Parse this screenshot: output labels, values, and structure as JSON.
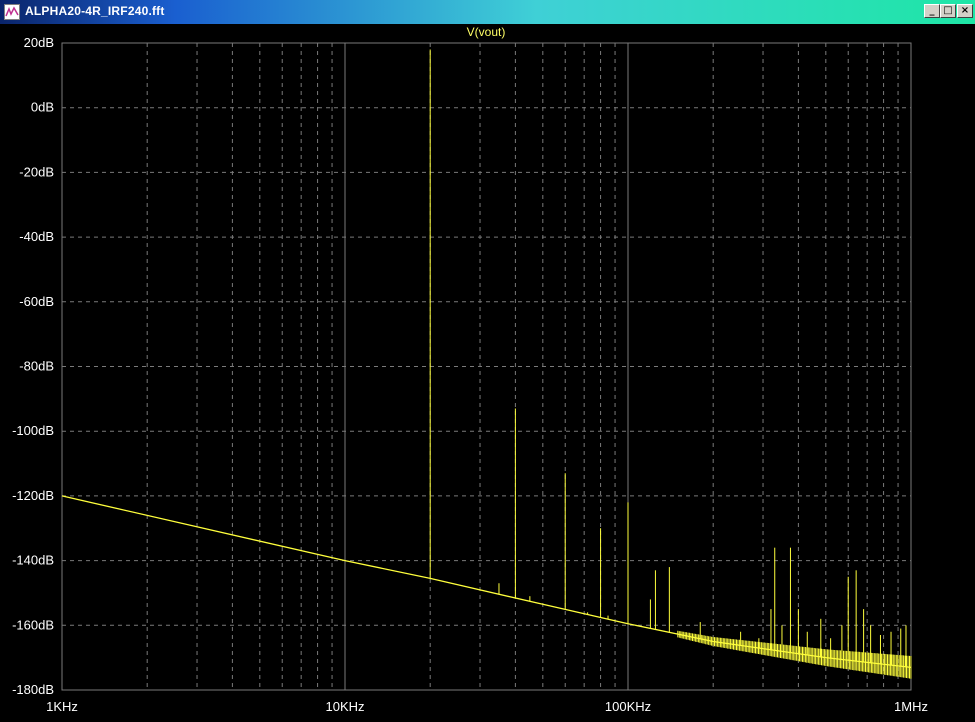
{
  "window": {
    "title": "ALPHA20-4R_IRF240.fft",
    "icon": "waveform-icon",
    "buttons": {
      "minimize": "_",
      "maximize": "□",
      "close": "×"
    }
  },
  "colors": {
    "background": "#000000",
    "grid": "#7a7a7a",
    "axis_text": "#ffffff",
    "trace": "#ffff3c",
    "trace_title": "#ffff66"
  },
  "chart_data": {
    "type": "line",
    "title": "V(vout)",
    "x_scale": "log",
    "xlim": [
      1000,
      1000000
    ],
    "ylim": [
      -180,
      20
    ],
    "x_tick_labels": [
      {
        "value": 1000,
        "label": "1KHz"
      },
      {
        "value": 10000,
        "label": "10KHz"
      },
      {
        "value": 100000,
        "label": "100KHz"
      },
      {
        "value": 1000000,
        "label": "1MHz"
      }
    ],
    "y_tick_labels": [
      {
        "value": 20,
        "label": "20dB"
      },
      {
        "value": 0,
        "label": "0dB"
      },
      {
        "value": -20,
        "label": "-20dB"
      },
      {
        "value": -40,
        "label": "-40dB"
      },
      {
        "value": -60,
        "label": "-60dB"
      },
      {
        "value": -80,
        "label": "-80dB"
      },
      {
        "value": -100,
        "label": "-100dB"
      },
      {
        "value": -120,
        "label": "-120dB"
      },
      {
        "value": -140,
        "label": "-140dB"
      },
      {
        "value": -160,
        "label": "-160dB"
      },
      {
        "value": -180,
        "label": "-180dB"
      }
    ],
    "grid": true,
    "series": [
      {
        "noise_floor": [
          [
            1000,
            -120
          ],
          [
            10000,
            -140
          ],
          [
            20000,
            -145.5
          ],
          [
            50000,
            -153.5
          ],
          [
            100000,
            -159.5
          ],
          [
            200000,
            -165
          ],
          [
            500000,
            -170
          ],
          [
            1000000,
            -173
          ]
        ],
        "spikes": [
          [
            20000,
            18
          ],
          [
            35000,
            -147
          ],
          [
            40000,
            -93
          ],
          [
            45000,
            -151
          ],
          [
            60000,
            -113
          ],
          [
            72000,
            -156
          ],
          [
            80000,
            -130
          ],
          [
            85000,
            -157
          ],
          [
            100000,
            -122
          ],
          [
            120000,
            -152
          ],
          [
            125000,
            -143
          ],
          [
            140000,
            -142
          ],
          [
            160000,
            -163
          ],
          [
            180000,
            -159
          ],
          [
            250000,
            -162
          ],
          [
            290000,
            -164
          ],
          [
            320000,
            -155
          ],
          [
            330000,
            -136
          ],
          [
            350000,
            -160
          ],
          [
            375000,
            -136
          ],
          [
            400000,
            -155
          ],
          [
            430000,
            -162
          ],
          [
            480000,
            -158
          ],
          [
            520000,
            -164
          ],
          [
            570000,
            -160
          ],
          [
            600000,
            -145
          ],
          [
            640000,
            -143
          ],
          [
            680000,
            -155
          ],
          [
            720000,
            -160
          ],
          [
            780000,
            -163
          ],
          [
            850000,
            -162
          ],
          [
            920000,
            -161
          ],
          [
            960000,
            -160
          ]
        ]
      }
    ]
  }
}
